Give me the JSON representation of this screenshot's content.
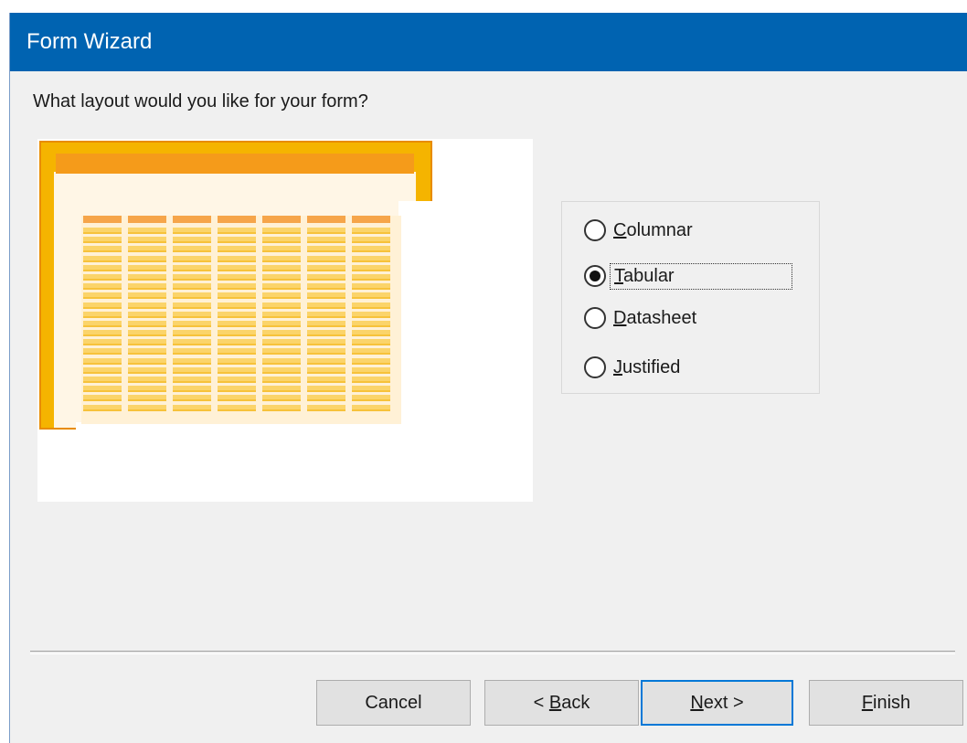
{
  "window": {
    "title": "Form Wizard"
  },
  "prompt": "What layout would you like for your form?",
  "layout_options": [
    {
      "key": "C",
      "rest": "olumnar",
      "selected": false
    },
    {
      "key": "T",
      "rest": "abular",
      "selected": true
    },
    {
      "key": "D",
      "rest": "atasheet",
      "selected": false
    },
    {
      "key": "J",
      "rest": "ustified",
      "selected": false
    }
  ],
  "buttons": {
    "cancel": "Cancel",
    "back_prefix": "< ",
    "back_key": "B",
    "back_rest": "ack",
    "next_key": "N",
    "next_rest": "ext >",
    "finish_key": "F",
    "finish_rest": "inish"
  },
  "colors": {
    "titlebar": "#0063b1",
    "preview_frame": "#f5b400",
    "preview_header": "#f59b1a",
    "preview_cell": "#fbd46a",
    "default_button_border": "#0078d7"
  }
}
